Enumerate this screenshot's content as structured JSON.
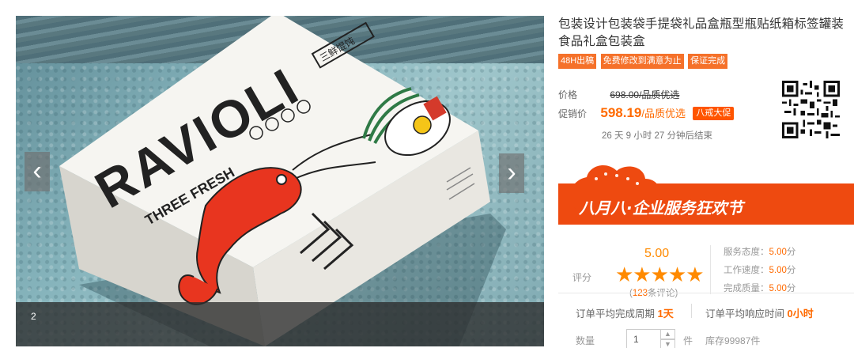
{
  "gallery": {
    "current_index": "2",
    "prev_arrow": "‹",
    "next_arrow": "›",
    "image": {
      "brand_text": "RAVIOLI",
      "sub_text": "THREE FRESH",
      "cn_circle_text": "三鲜馄饨",
      "cn_tag_text": "三鲜馄饨"
    }
  },
  "product": {
    "title": "包装设计包装袋手提袋礼品盒瓶型瓶贴纸箱标签罐装食品礼盒包装盒",
    "tags": [
      "48H出稿",
      "免费修改到满意为止",
      "保证完成"
    ]
  },
  "pricing": {
    "price_label": "价格",
    "original_price": "698.00/品质优选",
    "promo_label": "促销价",
    "promo_price": "598.19",
    "promo_suffix": "/品质优选",
    "promo_badge": "八戒大促",
    "countdown": "26 天 9 小时 27 分钟后结束"
  },
  "banner": {
    "text": "八月八·企业服务狂欢节",
    "color": "#ee4a10"
  },
  "rating": {
    "label": "评分",
    "score": "5.00",
    "stars": "★★★★★",
    "reviews_prefix": "(",
    "reviews_count": "123",
    "reviews_suffix": "条评论)",
    "service_attitude_label": "服务态度：",
    "service_attitude_value": "5.00",
    "work_speed_label": "工作速度：",
    "work_speed_value": "5.00",
    "quality_label": "完成质量：",
    "quality_value": "5.00",
    "score_unit": "分"
  },
  "orders": {
    "avg_complete_label": "订单平均完成周期",
    "avg_complete_value": "1天",
    "avg_response_label": "订单平均响应时间",
    "avg_response_value": "0小时"
  },
  "quantity": {
    "label": "数量",
    "value": "1",
    "up": "▲",
    "down": "▼",
    "unit": "件",
    "stock": "库存99987件"
  },
  "colors": {
    "accent": "#ff6a00",
    "tag_bg": "#f5712a",
    "banner_bg": "#ee4a10"
  }
}
